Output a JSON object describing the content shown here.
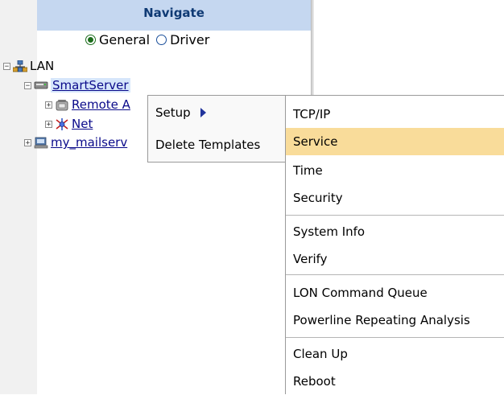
{
  "navigate": {
    "header": "Navigate",
    "radios": [
      {
        "label": "General",
        "checked": true
      },
      {
        "label": "Driver",
        "checked": false
      }
    ]
  },
  "tree": {
    "root": "LAN",
    "server": "SmartServer",
    "children": [
      {
        "label": "Remote A"
      },
      {
        "label": "Net"
      },
      {
        "label": "my_mailserv"
      }
    ]
  },
  "context_menu": {
    "items": [
      "Setup",
      "Delete Templates"
    ]
  },
  "submenu": {
    "items": [
      {
        "label": "TCP/IP",
        "highlighted": false
      },
      {
        "label": "Service",
        "highlighted": true
      },
      {
        "label": "Time",
        "highlighted": false
      },
      {
        "label": "Security",
        "highlighted": false
      },
      {
        "label": "System Info",
        "highlighted": false
      },
      {
        "label": "Verify",
        "highlighted": false
      },
      {
        "label": "LON Command Queue",
        "highlighted": false
      },
      {
        "label": "Powerline Repeating Analysis",
        "highlighted": false
      },
      {
        "label": "Clean Up",
        "highlighted": false
      },
      {
        "label": "Reboot",
        "highlighted": false
      }
    ]
  },
  "colors": {
    "header_bg": "#c5d7f0",
    "highlight": "#f9dc9a",
    "submenu_arrow": "#21349c"
  }
}
